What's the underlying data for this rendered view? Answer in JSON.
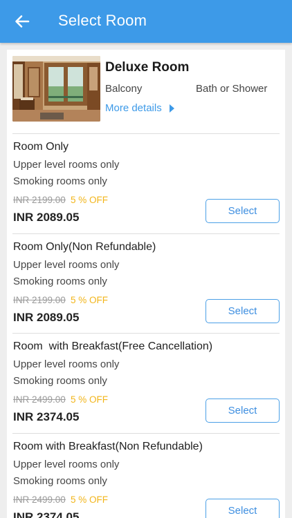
{
  "appbar": {
    "title": "Select Room",
    "back_icon": "arrow-left-icon",
    "color": "#3d9ae8"
  },
  "room": {
    "name": "Deluxe Room",
    "amenities": [
      "Balcony",
      "Bath or Shower"
    ],
    "more_details": "More details"
  },
  "plans": [
    {
      "name": "Room Only",
      "notes": [
        "Upper level rooms only",
        "Smoking rooms only"
      ],
      "original_price": "INR 2199.00",
      "discount": "5 % OFF",
      "price": "INR 2089.05",
      "select_label": "Select"
    },
    {
      "name": "Room Only(Non Refundable)",
      "notes": [
        "Upper level rooms only",
        "Smoking rooms only"
      ],
      "original_price": "INR 2199.00",
      "discount": "5 % OFF",
      "price": "INR 2089.05",
      "select_label": "Select"
    },
    {
      "name": "Room  with Breakfast(Free Cancellation)",
      "notes": [
        "Upper level rooms only",
        "Smoking rooms only"
      ],
      "original_price": "INR 2499.00",
      "discount": "5 % OFF",
      "price": "INR 2374.05",
      "select_label": "Select"
    },
    {
      "name": "Room with Breakfast(Non Refundable)",
      "notes": [
        "Upper level rooms only",
        "Smoking rooms only"
      ],
      "original_price": "INR 2499.00",
      "discount": "5 % OFF",
      "price": "INR 2374.05",
      "select_label": "Select"
    }
  ]
}
